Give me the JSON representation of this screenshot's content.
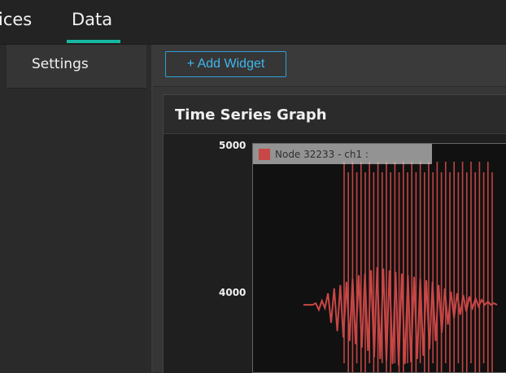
{
  "tabs": [
    {
      "label": "ices"
    },
    {
      "label": "Data"
    }
  ],
  "sidebar": {
    "settings_label": "Settings"
  },
  "toolbar": {
    "add_widget_label": "+ Add Widget"
  },
  "widget": {
    "title": "Time Series Graph"
  },
  "chart_data": {
    "type": "line",
    "yticks": [
      5000,
      4000
    ],
    "ylim": [
      3600,
      5000
    ],
    "series": [
      {
        "name": "Node 32233 - ch1 :",
        "color": "#c94746",
        "values": [
          4020,
          4020,
          4020,
          4020,
          4030,
          3990,
          4045,
          4000,
          4090,
          3910,
          4120,
          3860,
          4140,
          3820,
          4160,
          3800,
          4180,
          3780,
          4200,
          3760,
          4210,
          3740,
          4230,
          3700,
          4250,
          3690,
          4240,
          3680,
          4230,
          3660,
          4220,
          3650,
          4210,
          3660,
          4200,
          3670,
          4190,
          3690,
          4180,
          3710,
          4170,
          3750,
          4160,
          3800,
          4140,
          3850,
          4120,
          3900,
          4100,
          3940,
          4090,
          3960,
          4080,
          3980,
          4070,
          4000,
          4060,
          4010,
          4050,
          4020,
          4040,
          4020,
          4030,
          4020
        ]
      }
    ],
    "colors": {
      "accent": "#17b8a3",
      "button": "#3fb7ef"
    }
  }
}
